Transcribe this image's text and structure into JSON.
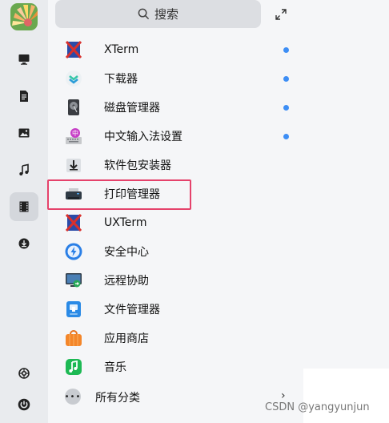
{
  "sidebar": {
    "items": [
      {
        "name": "monitor-icon"
      },
      {
        "name": "document-icon"
      },
      {
        "name": "image-icon"
      },
      {
        "name": "music-icon"
      },
      {
        "name": "film-icon",
        "active": true
      },
      {
        "name": "download-icon"
      },
      {
        "name": "settings-icon"
      },
      {
        "name": "power-icon"
      }
    ]
  },
  "search": {
    "placeholder": "搜索"
  },
  "apps": [
    {
      "label": "XTerm",
      "icon": "xterm-icon",
      "dot": true
    },
    {
      "label": "下载器",
      "icon": "downloader-icon",
      "dot": true
    },
    {
      "label": "磁盘管理器",
      "icon": "disk-manager-icon",
      "dot": true
    },
    {
      "label": "中文输入法设置",
      "icon": "input-method-icon",
      "dot": true
    },
    {
      "label": "软件包安装器",
      "icon": "package-installer-icon",
      "dot": false
    },
    {
      "label": "打印管理器",
      "icon": "printer-icon",
      "dot": false,
      "highlighted": true
    },
    {
      "label": "UXTerm",
      "icon": "uxterm-icon",
      "dot": false
    },
    {
      "label": "安全中心",
      "icon": "security-center-icon",
      "dot": false
    },
    {
      "label": "远程协助",
      "icon": "remote-assist-icon",
      "dot": false
    },
    {
      "label": "文件管理器",
      "icon": "file-manager-icon",
      "dot": false
    },
    {
      "label": "应用商店",
      "icon": "app-store-icon",
      "dot": false
    },
    {
      "label": "音乐",
      "icon": "music-app-icon",
      "dot": false
    }
  ],
  "all_categories": {
    "label": "所有分类"
  },
  "colors": {
    "accent": "#3d8ef5",
    "highlight": "#e5426b"
  },
  "watermark": "CSDN @yangyunjun"
}
